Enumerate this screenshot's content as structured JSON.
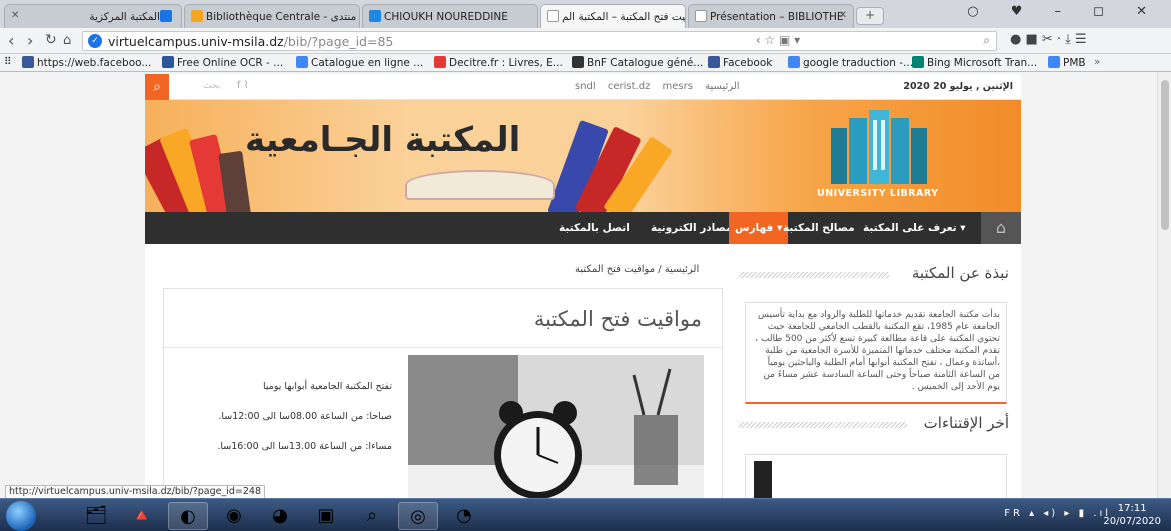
{
  "browser": {
    "tabs": [
      {
        "label": "المكتبة المركزية",
        "favicon_color": "#1a73e8"
      },
      {
        "label": "Bibliothèque Centrale - منتدى",
        "favicon_color": "#f5a623"
      },
      {
        "label": "CHIOUKH NOUREDDINE",
        "favicon_color": "#1e88e5"
      },
      {
        "label": "مواقيت فتح المكتبة – المكتبة الم",
        "favicon_color": "#ffffff"
      },
      {
        "label": "Présentation – BIBLIOTHE",
        "favicon_color": "#ffffff"
      }
    ],
    "new_tab": "+",
    "url_host": "virtuelcampus.univ-msila.dz",
    "url_path": "/bib/?page_id=85",
    "bookmarks": [
      {
        "label": "https://web.faceboo...",
        "color": "#3b5998"
      },
      {
        "label": "Free Online OCR - ...",
        "color": "#2b579a"
      },
      {
        "label": "Catalogue en ligne ...",
        "color": "#4285f4"
      },
      {
        "label": "Decitre.fr : Livres, E...",
        "color": "#e53935"
      },
      {
        "label": "BnF Catalogue géné...",
        "color": "#333333"
      },
      {
        "label": "Facebook",
        "color": "#3b5998"
      },
      {
        "label": "google traduction -...",
        "color": "#4285f4"
      },
      {
        "label": "Bing Microsoft Tran...",
        "color": "#008373"
      },
      {
        "label": "PMB",
        "color": "#4285f4"
      }
    ],
    "status_url": "http://virtuelcampus.univ-msila.dz/bib/?page_id=248"
  },
  "site": {
    "topbar": {
      "search_placeholder": "بحث",
      "links": [
        "sndl",
        "cerist.dz",
        "mesrs",
        "الرئيسية"
      ],
      "date": "الإثنين , يوليو 20 2020"
    },
    "banner": {
      "title": "المكتبة الجـامعية",
      "logo_text": "UNIVERSITY LIBRARY"
    },
    "nav": [
      {
        "label": "تعرف على المكتبة ▾",
        "active": false
      },
      {
        "label": "مصالح المكتبة",
        "active": false
      },
      {
        "label": "فهارس ▾",
        "active": true
      },
      {
        "label": "مصادر الكترونية ▾",
        "active": false
      },
      {
        "label": "اتصل بالمكتبة",
        "active": false
      }
    ],
    "breadcrumb": "الرئيسية  /  مواقيت فتح المكتبة",
    "post": {
      "title": "مواقيت فتح المكتبة",
      "lines": [
        "تفتح المكتبة الجامعية أبوابها يوميا",
        "صباحا: من الساعة 08.00سا الى 12:00سا.",
        "مساءا: من الساعة 13.00سا الى 16:00سا."
      ]
    },
    "sidebar": {
      "about_title": "نبذة عن المكتبة",
      "about_text": "بدأت مكتبة الجامعة تقديم خدماتها للطلبة والرواد مع بداية تأسيس الجامعة عام 1985، تقع المكتبة بالقطب الجامعي للجامعة حيث تحتوي المكتبة على قاعة مطالعة كبيرة تسع لأكثر من 500 طالب ، تقدم المكتبة مختلف خدماتها المتميزة للأسرة الجامعية من طلبة ،أساتذة وعمال ، تفتح المكتبة أبوابها أمام الطلبة والباحثين يومياً من الساعة الثامنة صباحاً وحتى الساعة السادسة عشر مساءً من يوم الأحد إلى الخميس .",
      "acq_title": "أخر الإقتناءات"
    },
    "accent": "#f26522"
  },
  "taskbar": {
    "tray_lang": "FR",
    "time": "17:11",
    "date": "20/07/2020"
  }
}
